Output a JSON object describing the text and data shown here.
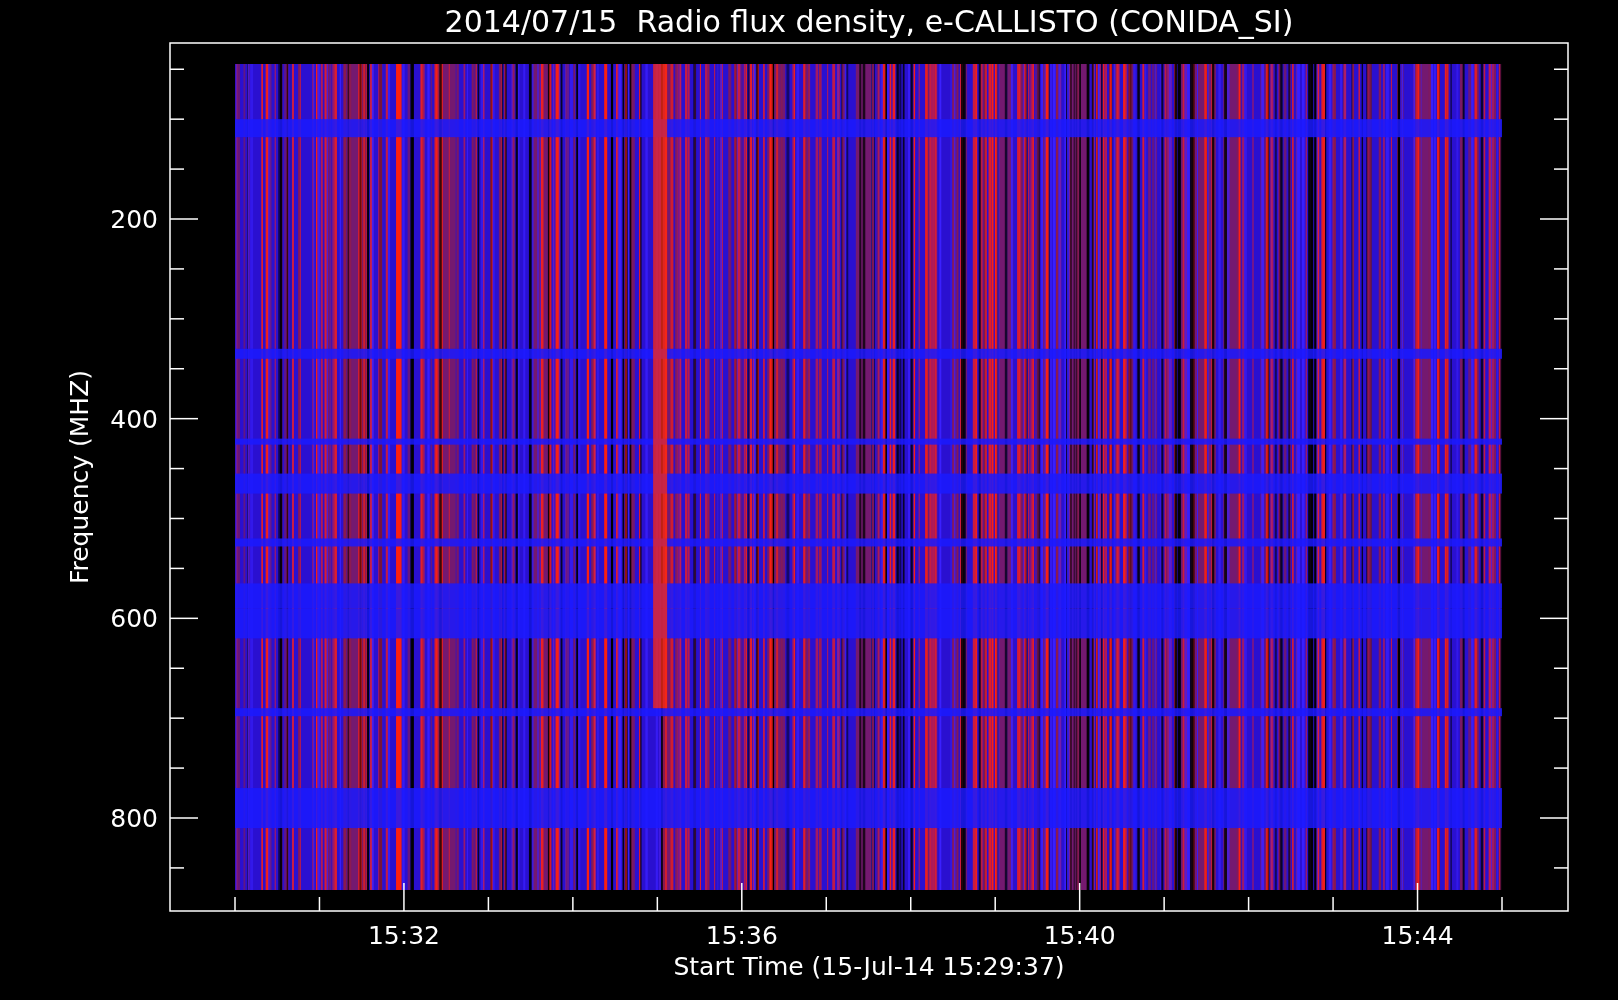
{
  "title": "2014/07/15  Radio flux density, e-CALLISTO (CONIDA_SI)",
  "y_axis": {
    "label": "Frequency (MHZ)",
    "ticks": [
      "200",
      "400",
      "600",
      "800"
    ]
  },
  "x_axis": {
    "label": "Start Time (15-Jul-14 15:29:37)",
    "ticks": [
      "15:32",
      "15:36",
      "15:40",
      "15:44"
    ]
  }
}
